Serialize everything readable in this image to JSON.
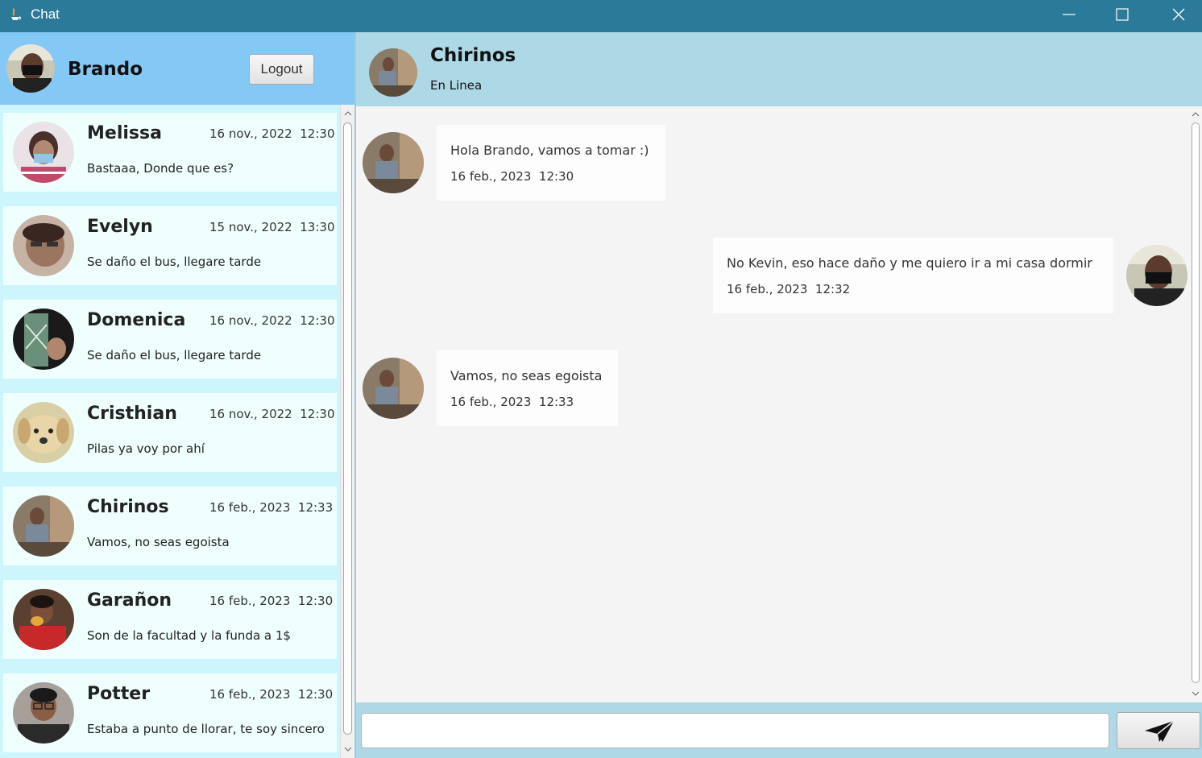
{
  "window": {
    "title": "Chat",
    "icon": "java-app-icon",
    "controls": [
      "minimize-icon",
      "maximize-icon",
      "close-icon"
    ]
  },
  "current_user": {
    "name": "Brando",
    "logout_label": "Logout"
  },
  "contacts": [
    {
      "name": "Melissa",
      "date": "16 nov., 2022  12:30",
      "preview": "Bastaaa, Donde que es?"
    },
    {
      "name": "Evelyn",
      "date": "15 nov., 2022  13:30",
      "preview": "Se daño el bus, llegare tarde"
    },
    {
      "name": "Domenica",
      "date": "16 nov., 2022  12:30",
      "preview": "Se daño el bus, llegare tarde"
    },
    {
      "name": "Cristhian",
      "date": "16 nov., 2022  12:30",
      "preview": "Pilas ya voy por ahí"
    },
    {
      "name": "Chirinos",
      "date": "16 feb., 2023  12:33",
      "preview": "Vamos, no seas egoista"
    },
    {
      "name": "Garañon",
      "date": "16 feb., 2023  12:30",
      "preview": "Son de la facultad y la funda a 1$"
    },
    {
      "name": "Potter",
      "date": "16 feb., 2023  12:30",
      "preview": "Estaba a punto de llorar, te soy sincero"
    }
  ],
  "chat": {
    "contact_name": "Chirinos",
    "status": "En Linea",
    "messages": [
      {
        "from": "Chirinos",
        "text": "Hola Brando, vamos a tomar :)",
        "time": "16 feb., 2023  12:30"
      },
      {
        "from": "Brando",
        "text": "No Kevin, eso hace daño y me quiero ir a mi casa dormir",
        "time": "16 feb., 2023  12:32"
      },
      {
        "from": "Chirinos",
        "text": "Vamos, no seas egoista",
        "time": "16 feb., 2023  12:33"
      }
    ],
    "input_value": "",
    "send_icon": "paper-plane-icon"
  },
  "colors": {
    "titlebar": "#2b7a99",
    "left_header": "#84c8f6",
    "chat_header": "#add8e6",
    "contact_card": "#eefffe",
    "contact_list_bg": "#ccf6fb"
  }
}
